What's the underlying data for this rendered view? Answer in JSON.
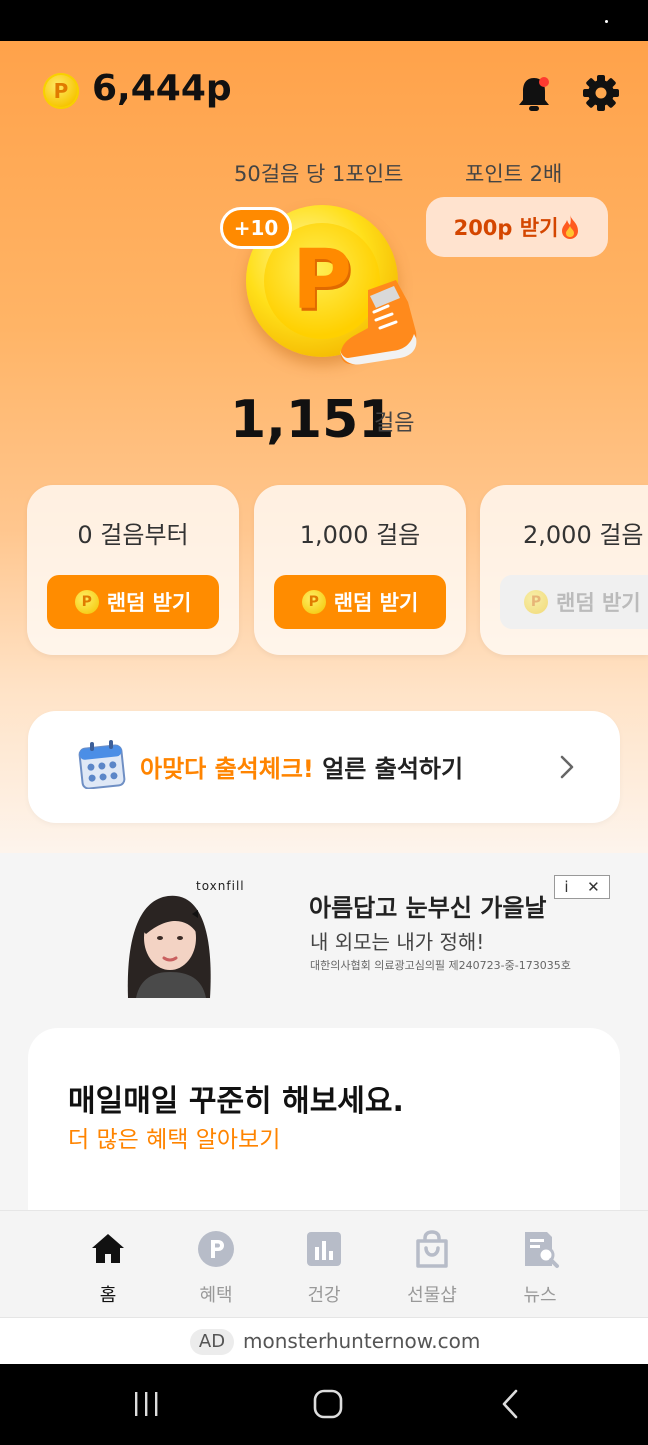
{
  "header": {
    "coin_letter": "P",
    "points_total": "6,444p"
  },
  "promo": {
    "rate_text": "50걸음 당 1포인트",
    "double_text": "포인트 2배",
    "get_points_label": "200p 받기"
  },
  "pedometer": {
    "bonus_badge": "+10",
    "coin_letter": "P",
    "steps": "1,151",
    "steps_unit": "걸음"
  },
  "reward_cards": [
    {
      "label": "0 걸음부터",
      "button": "랜덤 받기",
      "enabled": true
    },
    {
      "label": "1,000 걸음",
      "button": "랜덤 받기",
      "enabled": true
    },
    {
      "label": "2,000 걸음",
      "button": "랜덤 받기",
      "enabled": false
    }
  ],
  "attendance": {
    "accent": "아맞다 출석체크!",
    "text": " 얼른 출석하기"
  },
  "ad": {
    "brand": "toxnfill",
    "title": "아름답고 눈부신 가을날",
    "subtitle": "내 외모는 내가 정해!",
    "cert": "대한의사협회 의료광고심의필 제240723-중-173035호",
    "info_icon": "i",
    "close_icon": "✕"
  },
  "daily": {
    "title": "매일매일 꾸준히 해보세요.",
    "link": "더 많은 혜택 알아보기"
  },
  "tabs": [
    {
      "label": "홈",
      "icon": "home-icon",
      "active": true
    },
    {
      "label": "혜택",
      "icon": "point-icon",
      "active": false
    },
    {
      "label": "건강",
      "icon": "chart-icon",
      "active": false
    },
    {
      "label": "선물샵",
      "icon": "shopping-bag-icon",
      "active": false
    },
    {
      "label": "뉴스",
      "icon": "news-icon",
      "active": false
    }
  ],
  "ad_strip": {
    "tag": "AD",
    "url": "monsterhunternow.com"
  },
  "colors": {
    "accent": "#ff8c00",
    "hero_top": "#ffa24a",
    "text_dark": "#111111"
  }
}
